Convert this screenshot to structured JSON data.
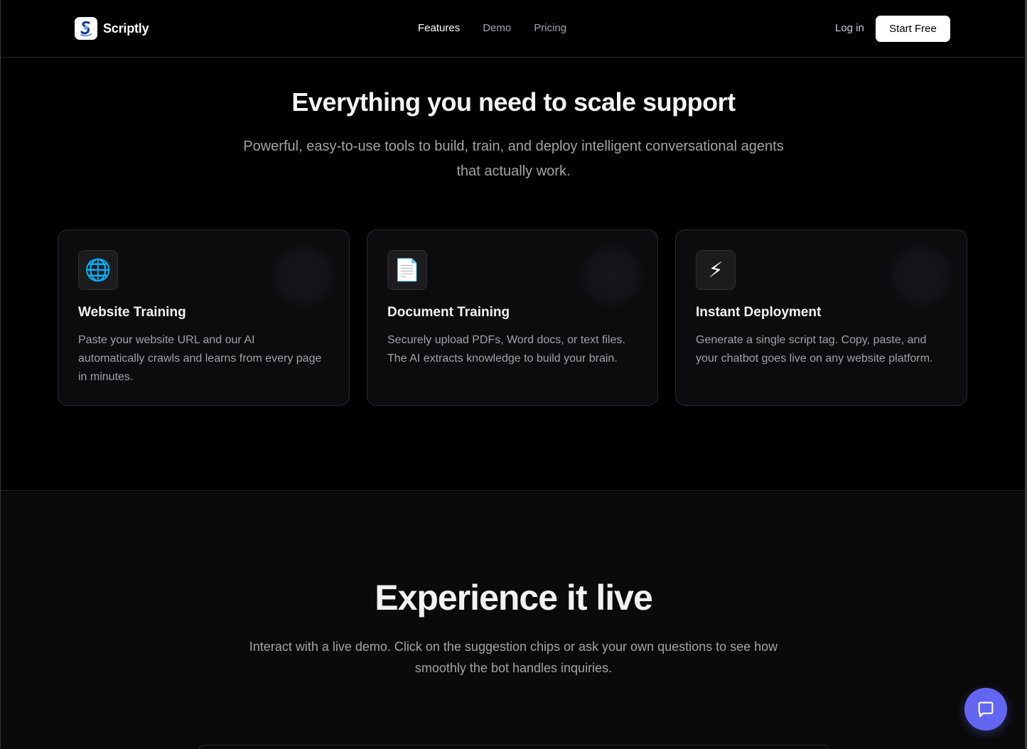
{
  "header": {
    "brand_name": "Scriptly",
    "nav": [
      {
        "label": "Features",
        "active": true
      },
      {
        "label": "Demo",
        "active": false
      },
      {
        "label": "Pricing",
        "active": false
      }
    ],
    "login_label": "Log in",
    "cta_label": "Start Free"
  },
  "features": {
    "title": "Everything you need to scale support",
    "subtitle": "Powerful, easy-to-use tools to build, train, and deploy intelligent conversational agents that actually work.",
    "cards": [
      {
        "icon": "globe-icon",
        "glyph": "🌐",
        "title": "Website Training",
        "description": "Paste your website URL and our AI automatically crawls and learns from every page in minutes."
      },
      {
        "icon": "document-icon",
        "glyph": "📄",
        "title": "Document Training",
        "description": "Securely upload PDFs, Word docs, or text files. The AI extracts knowledge to build your brain."
      },
      {
        "icon": "lightning-icon",
        "glyph": "⚡",
        "title": "Instant Deployment",
        "description": "Generate a single script tag. Copy, paste, and your chatbot goes live on any website platform."
      }
    ]
  },
  "demo": {
    "title": "Experience it live",
    "subtitle": "Interact with a live demo. Click on the suggestion chips or ask your own questions to see how smoothly the bot handles inquiries."
  },
  "colors": {
    "accent": "#6366f1",
    "background": "#000000",
    "card_bg": "#0c0c0e"
  }
}
